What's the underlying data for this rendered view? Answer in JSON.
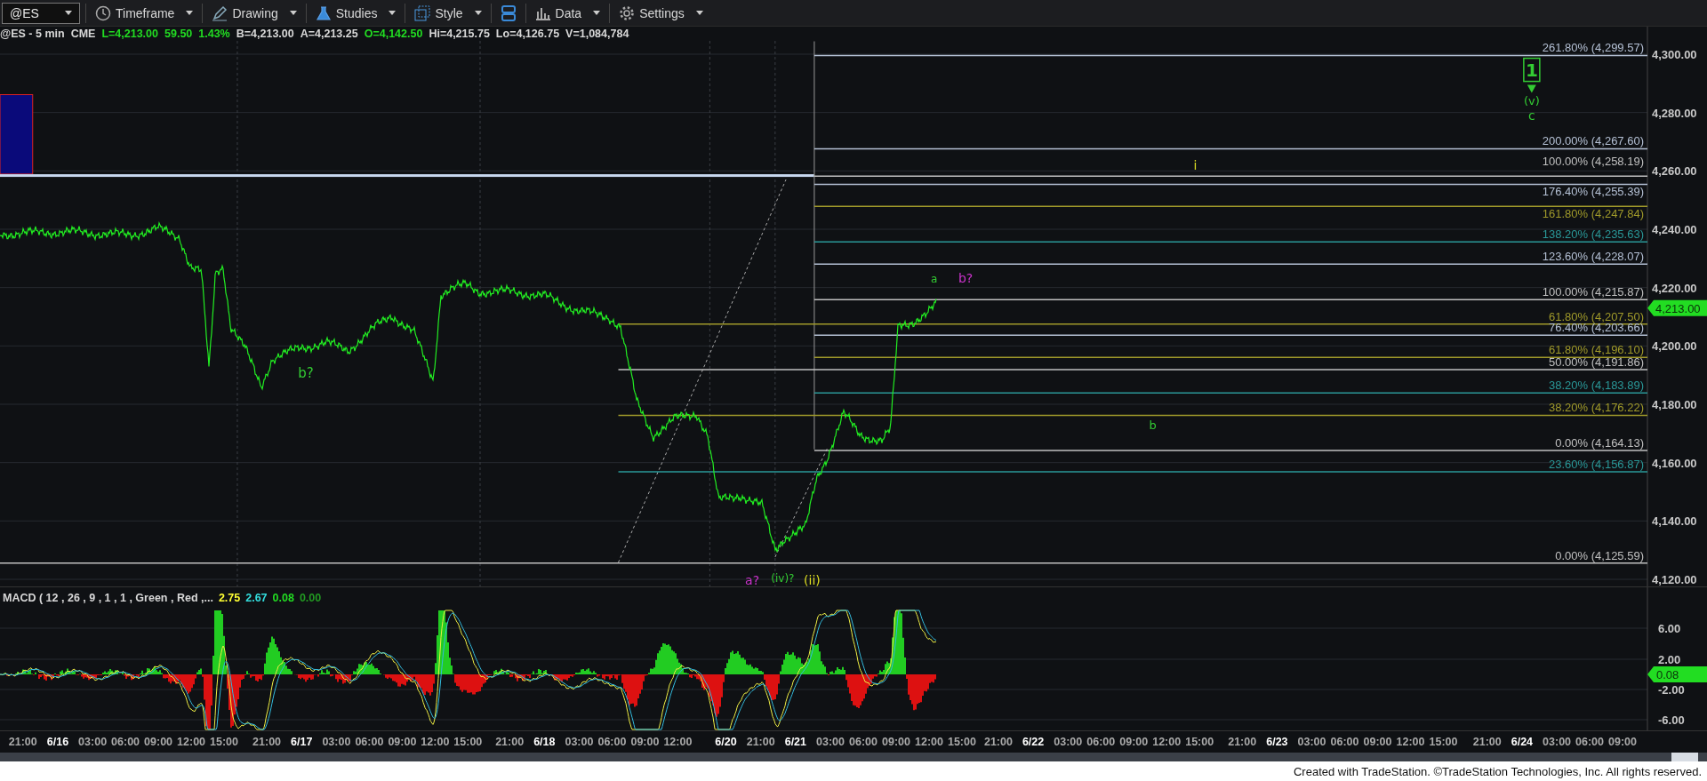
{
  "toolbar": {
    "symbol": "@ES",
    "items": [
      {
        "label": "Timeframe",
        "kind": "clock"
      },
      {
        "label": "Drawing",
        "kind": "pen"
      },
      {
        "label": "Studies",
        "kind": "flask"
      },
      {
        "label": "Style",
        "kind": "style"
      },
      {
        "kind": "layout"
      },
      {
        "label": "Data",
        "kind": "bars"
      },
      {
        "label": "Settings",
        "kind": "gear"
      }
    ]
  },
  "quote": [
    {
      "text": "@ES - 5 min",
      "color": "#d8d8d8"
    },
    {
      "text": "CME",
      "color": "#d8d8d8"
    },
    {
      "text": "L=4,213.00",
      "color": "#22dd22"
    },
    {
      "text": "59.50",
      "color": "#22dd22"
    },
    {
      "text": "1.43%",
      "color": "#22dd22"
    },
    {
      "text": "B=4,213.00",
      "color": "#d8d8d8"
    },
    {
      "text": "A=4,213.25",
      "color": "#d8d8d8"
    },
    {
      "text": "O=4,142.50",
      "color": "#22dd22"
    },
    {
      "text": "Hi=4,215.75",
      "color": "#d8d8d8"
    },
    {
      "text": "Lo=4,126.75",
      "color": "#d8d8d8"
    },
    {
      "text": "V=1,084,784",
      "color": "#d8d8d8"
    }
  ],
  "price_axis": [
    "4,300.00",
    "4,280.00",
    "4,260.00",
    "4,240.00",
    "4,220.00",
    "4,200.00",
    "4,180.00",
    "4,160.00",
    "4,140.00",
    "4,120.00"
  ],
  "last_price": "4,213.00",
  "fib_levels": [
    {
      "label": "261.80% (4,299.57)",
      "color": "#b4c0d4",
      "kind": "extension"
    },
    {
      "label": "200.00% (4,267.60)",
      "color": "#b4c0d4",
      "kind": "extension"
    },
    {
      "label": "100.00% (4,258.19)",
      "color": "#c0c0c0",
      "kind": "extension"
    },
    {
      "label": "176.40% (4,255.39)",
      "color": "#b4c0d4",
      "kind": "extension"
    },
    {
      "label": "161.80% (4,247.84)",
      "color": "#a09a2a",
      "kind": "extension"
    },
    {
      "label": "138.20% (4,235.63)",
      "color": "#2a9898",
      "kind": "extension"
    },
    {
      "label": "123.60% (4,228.07)",
      "color": "#b4c0d4",
      "kind": "extension"
    },
    {
      "label": "100.00% (4,215.87)",
      "color": "#c0c0c0",
      "kind": "extension"
    },
    {
      "label": "61.80% (4,207.50)",
      "color": "#a09a2a",
      "kind": "retracement"
    },
    {
      "label": "76.40% (4,203.66)",
      "color": "#b4c0d4",
      "kind": "extension"
    },
    {
      "label": "61.80% (4,196.10)",
      "color": "#a09a2a",
      "kind": "extension"
    },
    {
      "label": "50.00% (4,191.86)",
      "color": "#c0c0c0",
      "kind": "retracement"
    },
    {
      "label": "38.20% (4,183.89)",
      "color": "#2a9898",
      "kind": "extension"
    },
    {
      "label": "38.20% (4,176.22)",
      "color": "#a09a2a",
      "kind": "retracement"
    },
    {
      "label": "0.00% (4,164.13)",
      "color": "#c0c0c0",
      "kind": "extension"
    },
    {
      "label": "23.60% (4,156.87)",
      "color": "#2a9898",
      "kind": "retracement"
    },
    {
      "label": "0.00% (4,125.59)",
      "color": "#c0c0c0",
      "kind": "baseline"
    }
  ],
  "wave_labels": [
    {
      "text": "b?",
      "color": "#33cc33"
    },
    {
      "text": "a?",
      "color": "#cc33cc"
    },
    {
      "text": "(iv)?",
      "color": "#33cc33"
    },
    {
      "text": "(ii)",
      "color": "#dddd22"
    },
    {
      "text": "a",
      "color": "#33cc33"
    },
    {
      "text": "b?",
      "color": "#cc33cc"
    },
    {
      "text": "i",
      "color": "#dddd22"
    },
    {
      "text": "b",
      "color": "#33cc33"
    },
    {
      "text": "1",
      "color": "#33cc33"
    },
    {
      "text": "(v)",
      "color": "#33cc33"
    },
    {
      "text": "c",
      "color": "#33cc33"
    }
  ],
  "macd": {
    "legend": "MACD ( 12 , 26 , 9 , 1 , 1 , Green , Red ,...",
    "values": [
      {
        "text": "2.75",
        "color": "#ffff33"
      },
      {
        "text": "2.67",
        "color": "#33dddd"
      },
      {
        "text": "0.08",
        "color": "#22dd22"
      },
      {
        "text": "0.00",
        "color": "#229922"
      }
    ],
    "axis": [
      "6.00",
      "2.00",
      "-2.00",
      "-6.00"
    ],
    "last": "0.08"
  },
  "time_axis": [
    [
      {
        "text": "21:00",
        "kind": "time"
      },
      {
        "text": "6/16",
        "kind": "date"
      },
      {
        "text": "03:00",
        "kind": "time"
      },
      {
        "text": "06:00",
        "kind": "time"
      },
      {
        "text": "09:00",
        "kind": "time"
      },
      {
        "text": "12:00",
        "kind": "time"
      },
      {
        "text": "15:00",
        "kind": "time"
      }
    ],
    [
      {
        "text": "21:00",
        "kind": "time"
      },
      {
        "text": "6/17",
        "kind": "date"
      },
      {
        "text": "03:00",
        "kind": "time"
      },
      {
        "text": "06:00",
        "kind": "time"
      },
      {
        "text": "09:00",
        "kind": "time"
      },
      {
        "text": "12:00",
        "kind": "time"
      },
      {
        "text": "15:00",
        "kind": "time"
      }
    ],
    [
      {
        "text": "21:00",
        "kind": "time"
      },
      {
        "text": "6/18",
        "kind": "date"
      },
      {
        "text": "03:00",
        "kind": "time"
      },
      {
        "text": "06:00",
        "kind": "time"
      },
      {
        "text": "09:00",
        "kind": "time"
      },
      {
        "text": "12:00",
        "kind": "time"
      }
    ],
    [
      {
        "text": "6/20",
        "kind": "date"
      },
      {
        "text": "21:00",
        "kind": "time"
      },
      {
        "text": "6/21",
        "kind": "date"
      },
      {
        "text": "03:00",
        "kind": "time"
      },
      {
        "text": "06:00",
        "kind": "time"
      },
      {
        "text": "09:00",
        "kind": "time"
      },
      {
        "text": "12:00",
        "kind": "time"
      },
      {
        "text": "15:00",
        "kind": "time"
      }
    ],
    [
      {
        "text": "21:00",
        "kind": "time"
      },
      {
        "text": "6/22",
        "kind": "date"
      },
      {
        "text": "03:00",
        "kind": "time"
      },
      {
        "text": "06:00",
        "kind": "time"
      },
      {
        "text": "09:00",
        "kind": "time"
      },
      {
        "text": "12:00",
        "kind": "time"
      },
      {
        "text": "15:00",
        "kind": "time"
      }
    ],
    [
      {
        "text": "21:00",
        "kind": "time"
      },
      {
        "text": "6/23",
        "kind": "date"
      },
      {
        "text": "03:00",
        "kind": "time"
      },
      {
        "text": "06:00",
        "kind": "time"
      },
      {
        "text": "09:00",
        "kind": "time"
      },
      {
        "text": "12:00",
        "kind": "time"
      },
      {
        "text": "15:00",
        "kind": "time"
      }
    ],
    [
      {
        "text": "21:00",
        "kind": "time"
      },
      {
        "text": "6/24",
        "kind": "date"
      },
      {
        "text": "03:00",
        "kind": "time"
      },
      {
        "text": "06:00",
        "kind": "time"
      },
      {
        "text": "09:00",
        "kind": "time"
      }
    ]
  ],
  "footer": "Created with TradeStation. ©TradeStation Technologies, Inc. All rights reserved."
}
